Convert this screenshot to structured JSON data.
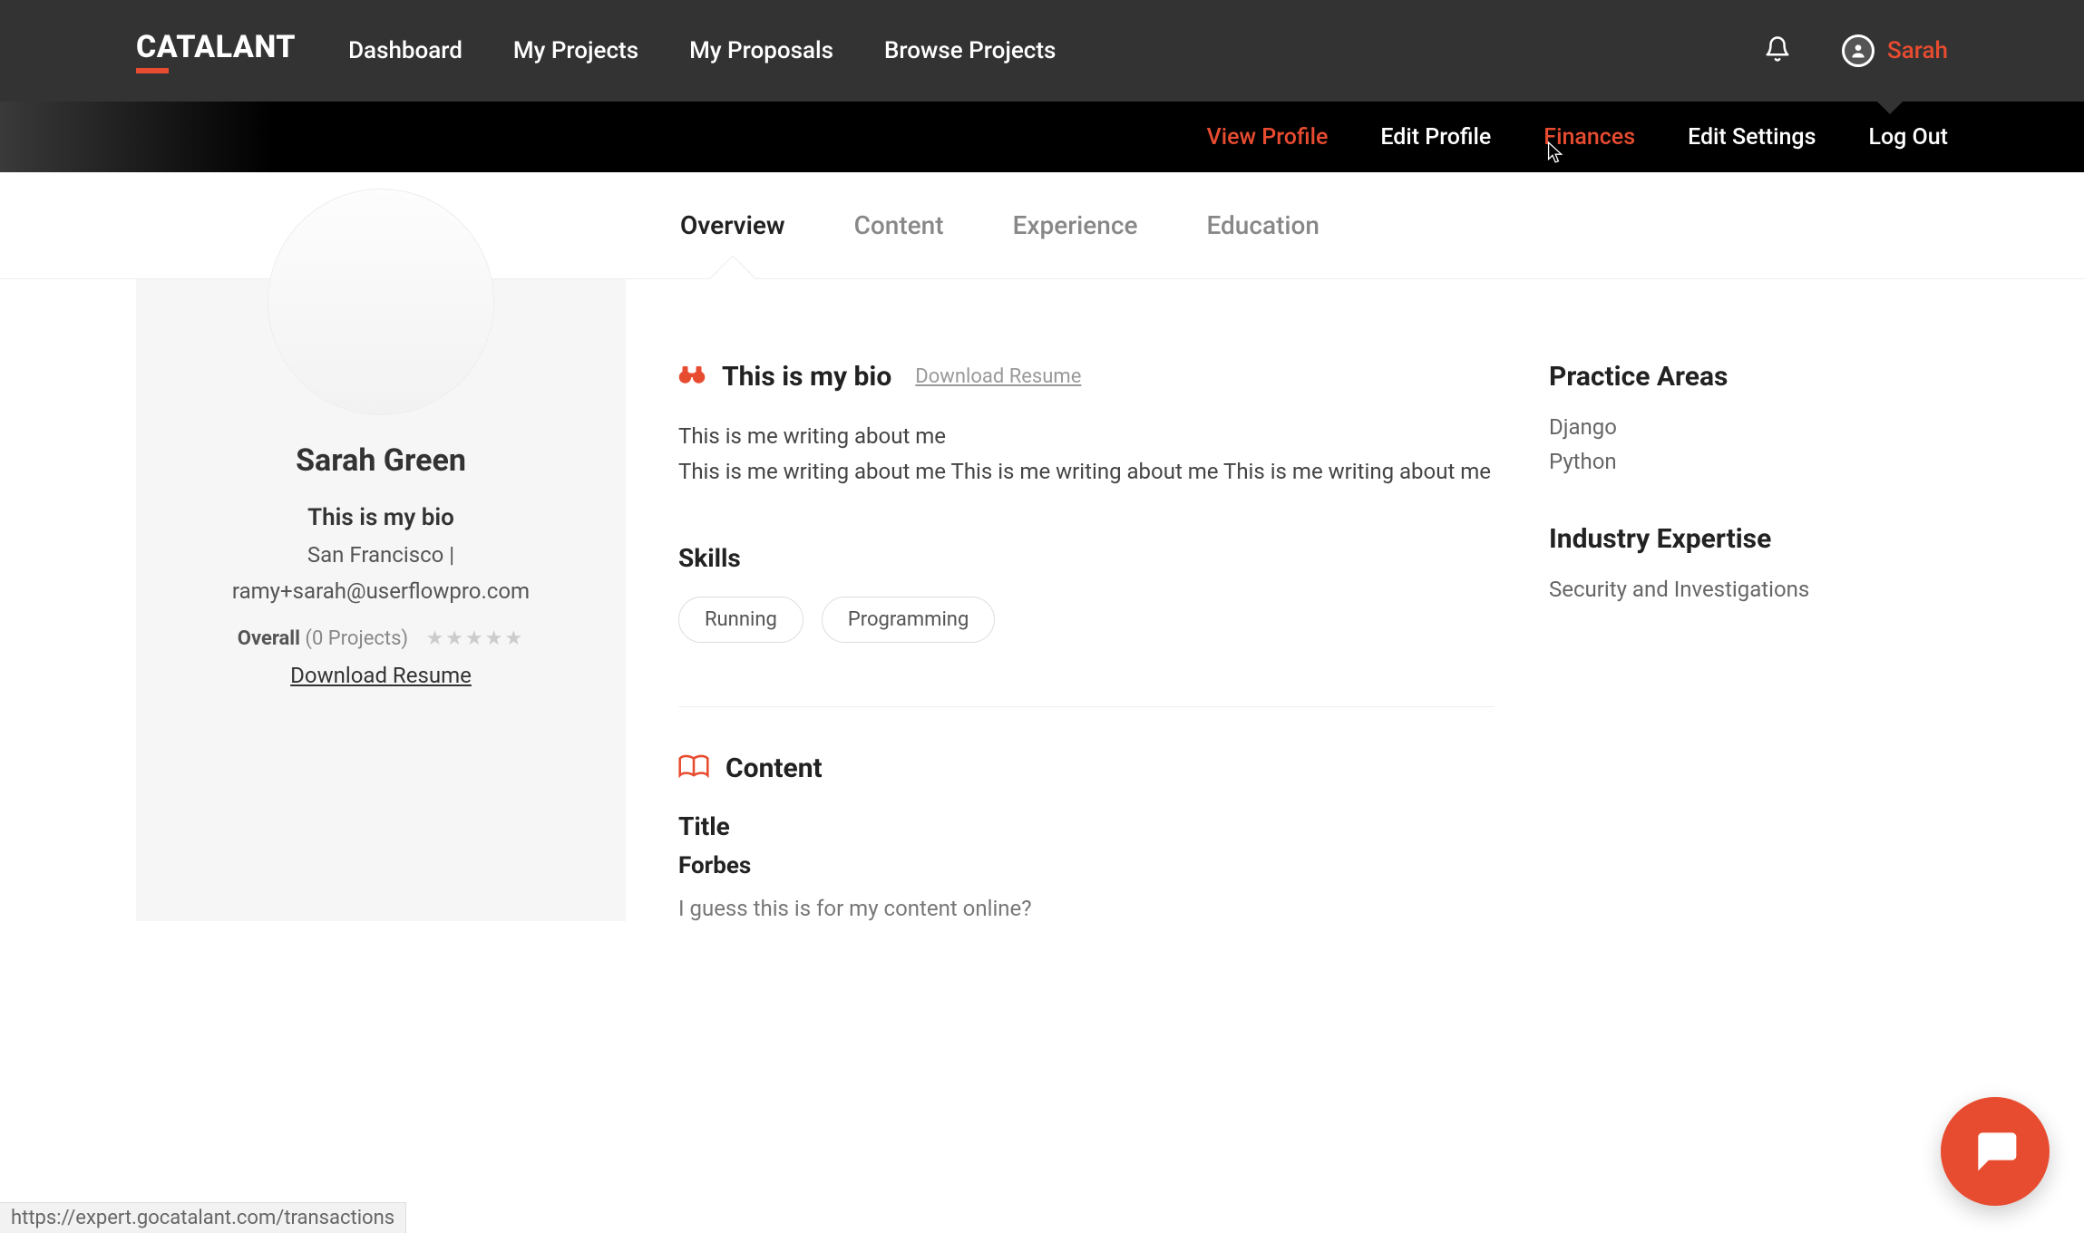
{
  "brand": "CATALANT",
  "nav": {
    "items": [
      "Dashboard",
      "My Projects",
      "My Proposals",
      "Browse Projects"
    ]
  },
  "user": {
    "name": "Sarah"
  },
  "subnav": {
    "items": [
      {
        "label": "View Profile",
        "active": true
      },
      {
        "label": "Edit Profile",
        "active": false
      },
      {
        "label": "Finances",
        "active": true
      },
      {
        "label": "Edit Settings",
        "active": false
      },
      {
        "label": "Log Out",
        "active": false
      }
    ]
  },
  "tabs": {
    "items": [
      {
        "label": "Overview",
        "active": true
      },
      {
        "label": "Content",
        "active": false
      },
      {
        "label": "Experience",
        "active": false
      },
      {
        "label": "Education",
        "active": false
      }
    ]
  },
  "profile": {
    "name": "Sarah Green",
    "bio_short": "This is my bio",
    "location_line": "San Francisco |",
    "email": "ramy+sarah@userflowpro.com",
    "overall_label": "Overall",
    "projects_count_label": "(0 Projects)",
    "download_resume": "Download Resume"
  },
  "bio_section": {
    "title": "This is my bio",
    "download_resume": "Download Resume",
    "p1": "This is me writing about me",
    "p2": " This is me writing about me This is me writing about me This is me writing about me"
  },
  "skills": {
    "heading": "Skills",
    "items": [
      "Running",
      "Programming"
    ]
  },
  "content_section": {
    "heading": "Content",
    "title_label": "Title",
    "publication": "Forbes",
    "desc": "I guess this is for my content online?"
  },
  "right": {
    "practice_heading": "Practice Areas",
    "practice_items": [
      "Django",
      "Python"
    ],
    "industry_heading": "Industry Expertise",
    "industry_items": [
      "Security and Investigations"
    ]
  },
  "status_url": "https://expert.gocatalant.com/transactions"
}
